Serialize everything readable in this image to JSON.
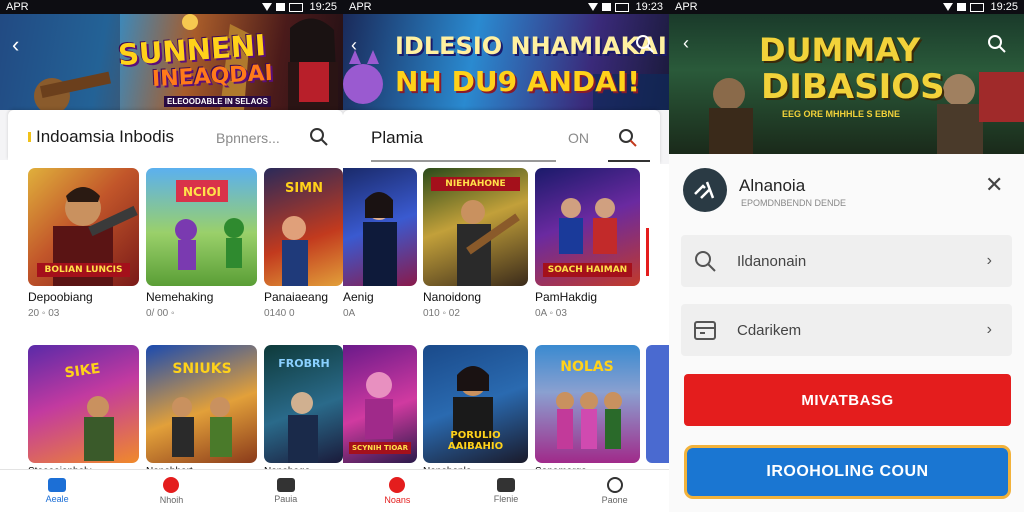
{
  "panel1": {
    "status": {
      "carrier": "APR",
      "time": "19:25"
    },
    "banner": {
      "title_line1": "SUNNENI",
      "title_line2": "INEAQDAI",
      "subtitle": "ELEOODABLE IN SELAOS"
    },
    "search": {
      "title": "Indoamsia Inbodis",
      "placeholder": "Bpnners..."
    },
    "games": [
      {
        "name": "Depoobiang",
        "meta": "20 ◦ 03",
        "tile_label": "BOLIAN LUNCIS"
      },
      {
        "name": "Nemehaking",
        "meta": "0/ 00 ◦",
        "tile_label": ""
      },
      {
        "name": "Panaiaeang",
        "meta": "0140 0",
        "tile_label": ""
      },
      {
        "name": "Steeaaionhaly",
        "meta": "",
        "tile_label": ""
      },
      {
        "name": "Nenebhart",
        "meta": "",
        "tile_label": ""
      },
      {
        "name": "Nonahage",
        "meta": "",
        "tile_label": ""
      }
    ],
    "nav": [
      {
        "label": "Aeale",
        "icon": "home-icon"
      },
      {
        "label": "Nhoih",
        "icon": "fire-icon"
      },
      {
        "label": "Pauia",
        "icon": "gamepad-icon"
      }
    ]
  },
  "panel2": {
    "status": {
      "carrier": "APR",
      "time": "19:23"
    },
    "banner": {
      "title_line1": "IDLESIO NHAMIAKAI",
      "title_line2": "NH DU9 ANDAI!"
    },
    "search": {
      "title": "Plamia",
      "placeholder": "ON"
    },
    "games": [
      {
        "name": "Aenig",
        "meta": "0A",
        "tile_label": ""
      },
      {
        "name": "Nanoidong",
        "meta": "010 ◦ 02",
        "tile_label": "NIEHAHONE"
      },
      {
        "name": "PamHakdig",
        "meta": "0A ◦ 03",
        "tile_label": "SOACH HAIMAN"
      },
      {
        "name": "",
        "meta": "",
        "tile_label": "SCYNIH TIOAR"
      },
      {
        "name": "Nenehonle",
        "meta": "",
        "tile_label": "PORULIO AAIBAHIO"
      },
      {
        "name": "Sonamarge",
        "meta": "",
        "tile_label": ""
      }
    ],
    "nav": [
      {
        "label": "Noans",
        "icon": "fire-icon"
      },
      {
        "label": "Flenie",
        "icon": "gamepad-icon"
      },
      {
        "label": "Paone",
        "icon": "user-icon"
      }
    ]
  },
  "panel3": {
    "status": {
      "carrier": "APR",
      "time": "19:25"
    },
    "banner": {
      "title_line1": "DUMMAY",
      "title_line2": "DIBASIOS",
      "subtitle": "EEG ORE MHHHLE S EBNE"
    },
    "account": {
      "name": "Alnanoia",
      "subtitle": "EPOMDNBENDN DENDE"
    },
    "rows": [
      {
        "label": "Ildanonain",
        "icon": "search-icon"
      },
      {
        "label": "Cdarikem",
        "icon": "calendar-icon"
      }
    ],
    "buttons": {
      "primary": "MIVATBASG",
      "secondary": "IROOHOLING COUN"
    }
  },
  "colors": {
    "accent_red": "#e41d1d",
    "accent_blue": "#1a76d2",
    "nav_active": "#1c6fd6",
    "banner_gold": "#ffd21a"
  }
}
